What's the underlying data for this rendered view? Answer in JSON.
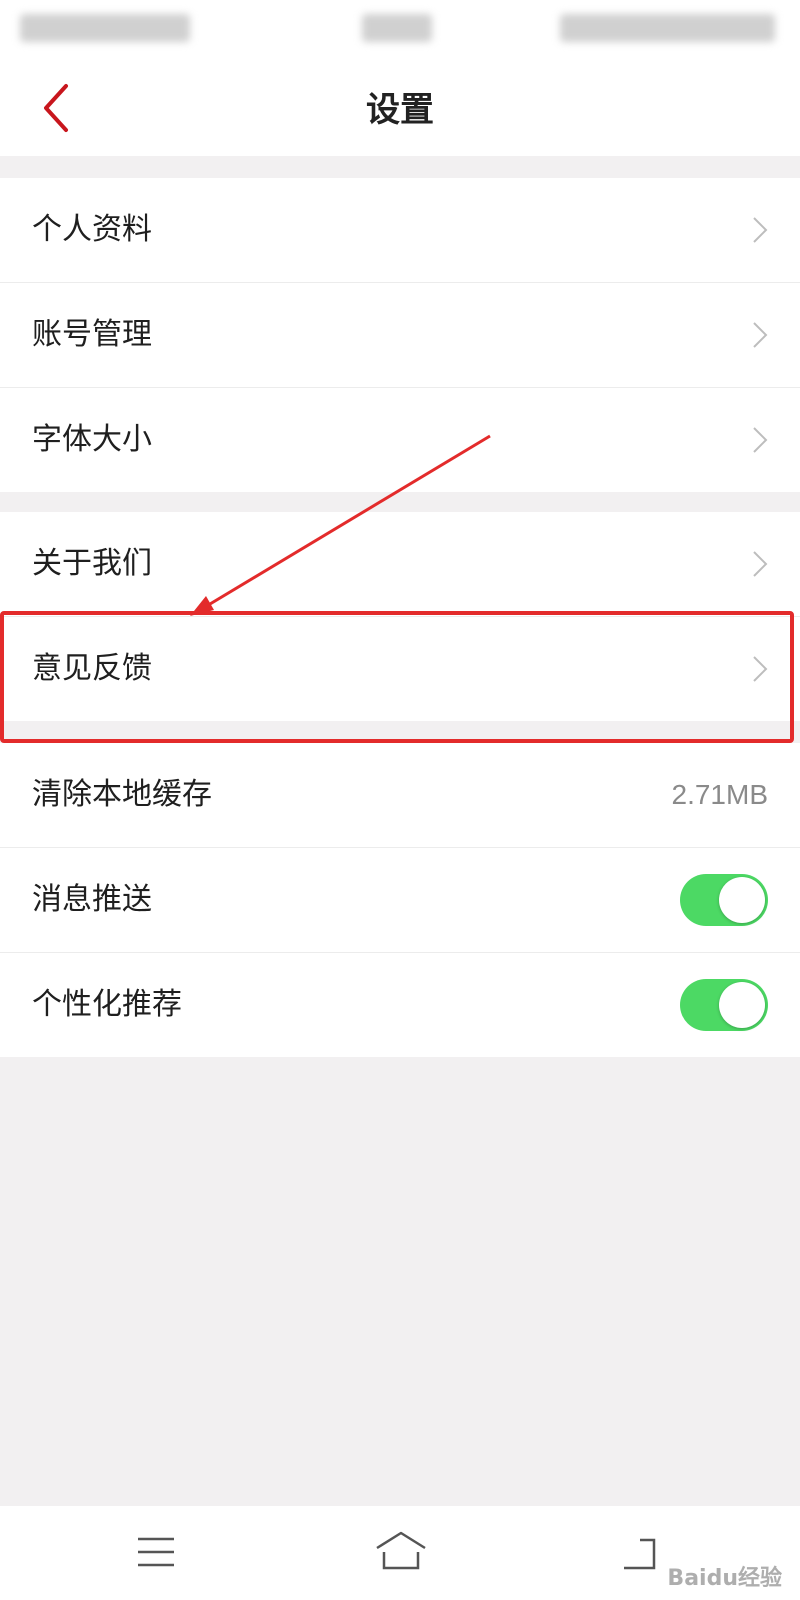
{
  "header": {
    "title": "设置"
  },
  "groups": [
    {
      "items": [
        {
          "label": "个人资料"
        },
        {
          "label": "账号管理"
        },
        {
          "label": "字体大小"
        }
      ]
    },
    {
      "items": [
        {
          "label": "关于我们"
        },
        {
          "label": "意见反馈"
        }
      ]
    },
    {
      "items": [
        {
          "label": "清除本地缓存",
          "value": "2.71MB"
        },
        {
          "label": "消息推送",
          "toggle": true
        },
        {
          "label": "个性化推荐",
          "toggle": true
        }
      ]
    }
  ],
  "colors": {
    "accent": "#c8161d",
    "toggle_on": "#4cd964",
    "highlight": "#e32b2b"
  },
  "navbar": {
    "icons": [
      "menu-icon",
      "home-icon",
      "back-nav-icon"
    ]
  },
  "watermark": "Baidu经验"
}
